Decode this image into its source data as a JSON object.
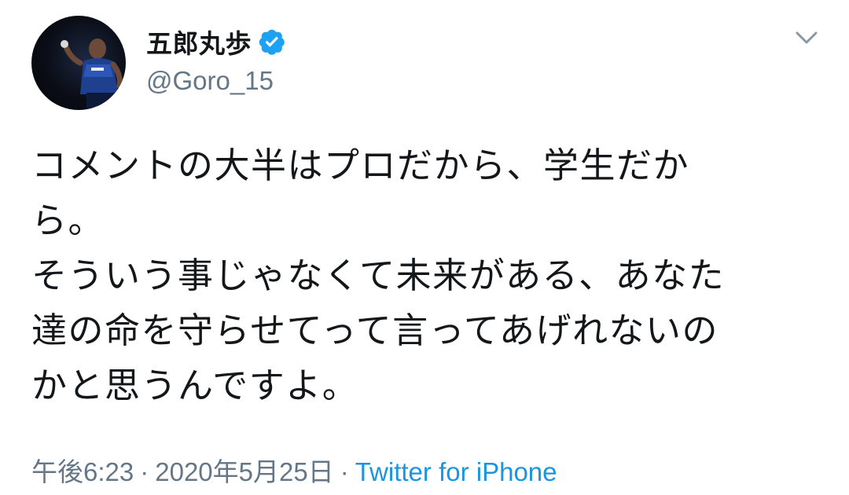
{
  "user": {
    "display_name": "五郎丸歩",
    "handle": "@Goro_15",
    "verified": true,
    "verified_icon": "verified-badge-icon",
    "verified_color": "#1da1f2"
  },
  "tweet": {
    "lines": [
      "コメントの大半はプロだから、学生だか",
      "ら。",
      "そういう事じゃなくて未来がある、あなた",
      "達の命を守らせてって言ってあげれないの",
      "かと思うんですよ。"
    ],
    "time": "午後6:23",
    "date": "2020年5月25日",
    "separator": "·",
    "source": "Twitter for iPhone",
    "source_color": "#1b95e0"
  },
  "menu": {
    "icon": "chevron-down-icon"
  }
}
